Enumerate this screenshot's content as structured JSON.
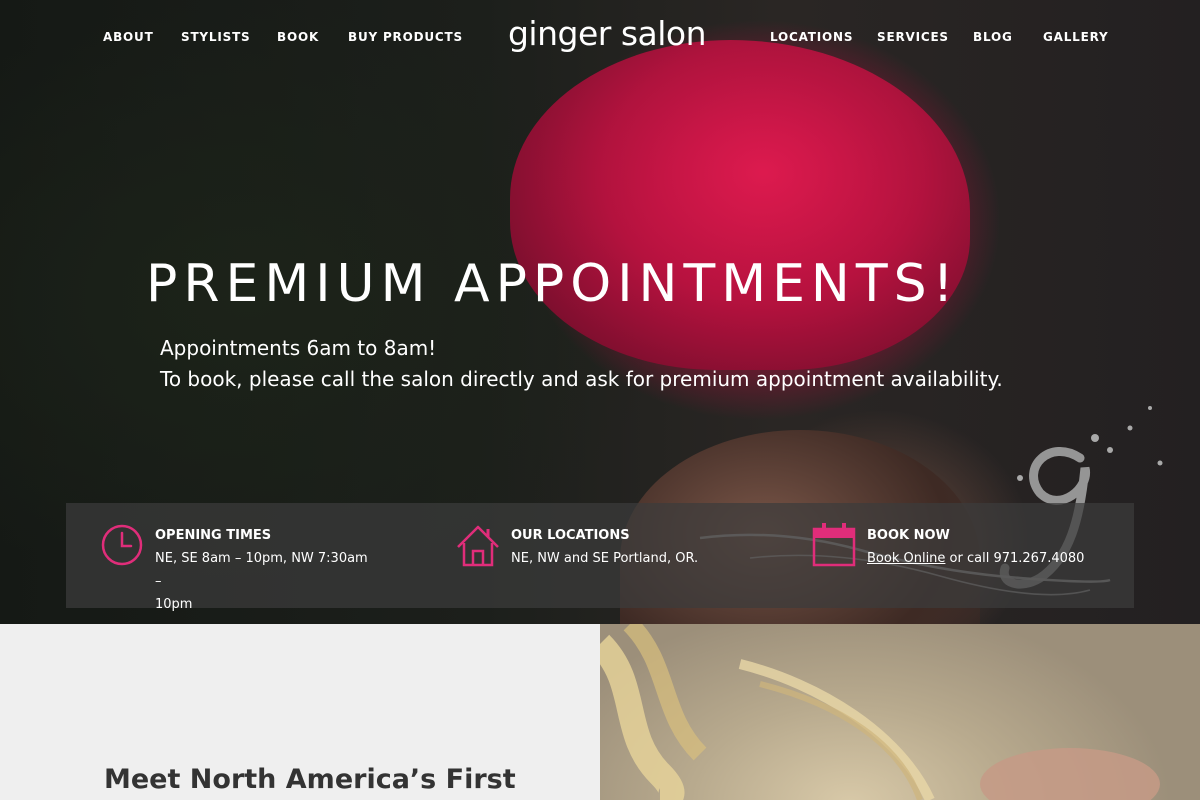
{
  "nav": {
    "left": [
      "ABOUT",
      "STYLISTS",
      "BOOK",
      "BUY PRODUCTS"
    ],
    "logo": "ginger salon",
    "right": [
      "LOCATIONS",
      "SERVICES",
      "BLOG",
      "GALLERY"
    ]
  },
  "hero": {
    "headline": "PREMIUM APPOINTMENTS!",
    "line1": "Appointments 6am to 8am!",
    "line2": "To book, please call the salon directly and ask for premium appointment availability."
  },
  "info": {
    "hours": {
      "title": "OPENING TIMES",
      "line1": "NE, SE 8am – 10pm, NW 7:30am –",
      "line2": "10pm",
      "icon": "clock-icon"
    },
    "locations": {
      "title": "OUR LOCATIONS",
      "text": "NE, NW and SE Portland, OR.",
      "icon": "home-icon"
    },
    "book": {
      "title": "BOOK NOW",
      "link": "Book Online",
      "rest": " or call 971.267.4080",
      "icon": "calendar-icon"
    }
  },
  "colors": {
    "accent": "#e02d7a",
    "bar": "#3c3c3c",
    "lower_bg": "#efefef",
    "text_dark": "#333333"
  },
  "section": {
    "title": "Meet North America’s First"
  }
}
